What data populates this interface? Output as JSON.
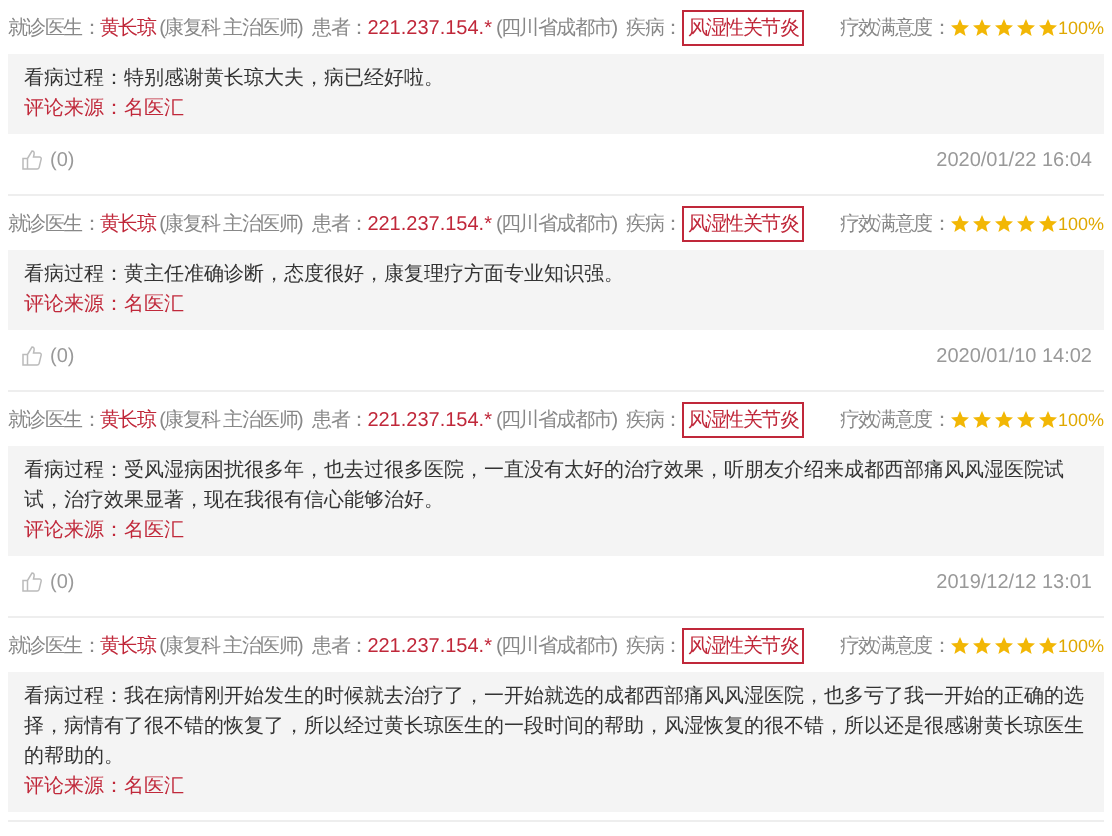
{
  "reviews": [
    {
      "doctor_label": "就诊医生：",
      "doctor": "黄长琼",
      "department": "(康复科 主治医师)",
      "patient_label": "患者：",
      "patient": "221.237.154.*",
      "location": "(四川省成都市)",
      "disease_label": "疾病：",
      "disease": "风湿性关节炎",
      "rating_label": "疗效满意度：",
      "stars": 5,
      "rating": "100%",
      "process_label": "看病过程：",
      "process": "特别感谢黄长琼大夫，病已经好啦。",
      "source_label": "评论来源：",
      "source": "名医汇",
      "likes": "(0)",
      "date": "2020/01/22 16:04"
    },
    {
      "doctor_label": "就诊医生：",
      "doctor": "黄长琼",
      "department": "(康复科 主治医师)",
      "patient_label": "患者：",
      "patient": "221.237.154.*",
      "location": "(四川省成都市)",
      "disease_label": "疾病：",
      "disease": "风湿性关节炎",
      "rating_label": "疗效满意度：",
      "stars": 5,
      "rating": "100%",
      "process_label": "看病过程：",
      "process": "黄主任准确诊断，态度很好，康复理疗方面专业知识强。",
      "source_label": "评论来源：",
      "source": "名医汇",
      "likes": "(0)",
      "date": "2020/01/10 14:02"
    },
    {
      "doctor_label": "就诊医生：",
      "doctor": "黄长琼",
      "department": "(康复科 主治医师)",
      "patient_label": "患者：",
      "patient": "221.237.154.*",
      "location": "(四川省成都市)",
      "disease_label": "疾病：",
      "disease": "风湿性关节炎",
      "rating_label": "疗效满意度：",
      "stars": 5,
      "rating": "100%",
      "process_label": "看病过程：",
      "process": "受风湿病困扰很多年，也去过很多医院，一直没有太好的治疗效果，听朋友介绍来成都西部痛风风湿医院试试，治疗效果显著，现在我很有信心能够治好。",
      "source_label": "评论来源：",
      "source": "名医汇",
      "likes": "(0)",
      "date": "2019/12/12 13:01"
    },
    {
      "doctor_label": "就诊医生：",
      "doctor": "黄长琼",
      "department": "(康复科 主治医师)",
      "patient_label": "患者：",
      "patient": "221.237.154.*",
      "location": "(四川省成都市)",
      "disease_label": "疾病：",
      "disease": "风湿性关节炎",
      "rating_label": "疗效满意度：",
      "stars": 5,
      "rating": "100%",
      "process_label": "看病过程：",
      "process": "我在病情刚开始发生的时候就去治疗了，一开始就选的成都西部痛风风湿医院，也多亏了我一开始的正确的选择，病情有了很不错的恢复了，所以经过黄长琼医生的一段时间的帮助，风湿恢复的很不错，所以还是很感谢黄长琼医生的帮助的。",
      "source_label": "评论来源：",
      "source": "名医汇"
    }
  ]
}
